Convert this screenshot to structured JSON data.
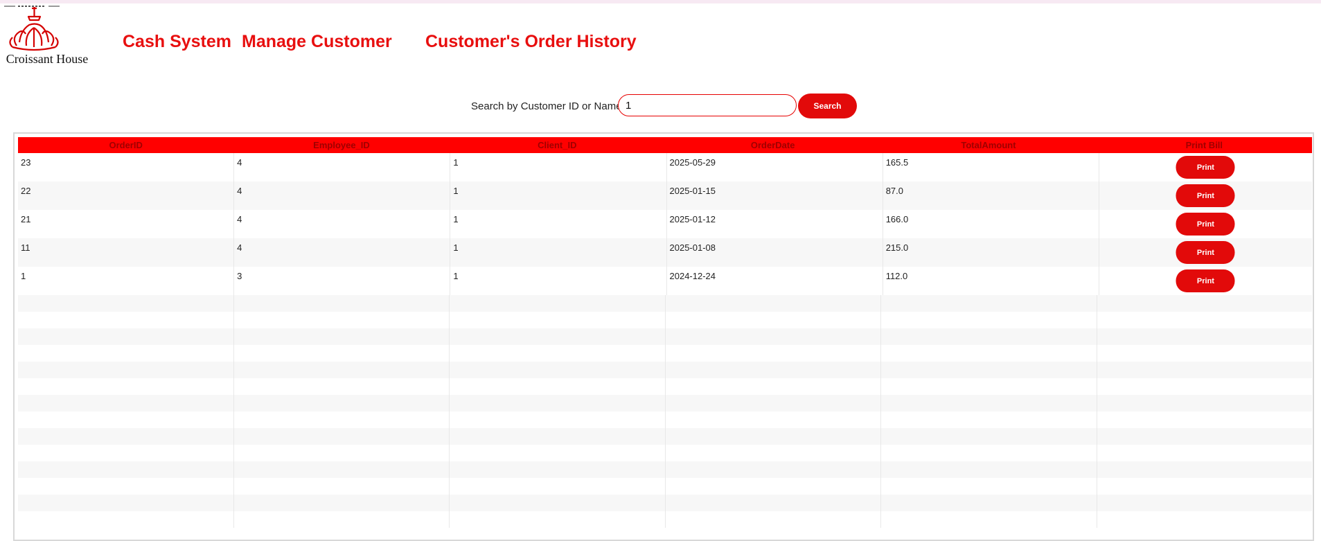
{
  "brand": {
    "name": "Croissant House",
    "accent_color": "#e80f0f",
    "logo_icon": "croissant-icon"
  },
  "nav": {
    "items": [
      {
        "label": "Cash System"
      },
      {
        "label": "Manage Customer"
      },
      {
        "label": "Customer's Order History"
      }
    ]
  },
  "search": {
    "label": "Search by Customer ID or Name:",
    "value": "1",
    "button_label": "Search"
  },
  "table": {
    "columns": [
      "OrderID",
      "Employee_ID",
      "Client_ID",
      "OrderDate",
      "TotalAmount",
      "Print Bill"
    ],
    "rows": [
      {
        "order_id": "23",
        "employee_id": "4",
        "client_id": "1",
        "order_date": "2025-05-29",
        "total": "165.5",
        "action": "Print"
      },
      {
        "order_id": "22",
        "employee_id": "4",
        "client_id": "1",
        "order_date": "2025-01-15",
        "total": "87.0",
        "action": "Print"
      },
      {
        "order_id": "21",
        "employee_id": "4",
        "client_id": "1",
        "order_date": "2025-01-12",
        "total": "166.0",
        "action": "Print"
      },
      {
        "order_id": "11",
        "employee_id": "4",
        "client_id": "1",
        "order_date": "2025-01-08",
        "total": "215.0",
        "action": "Print"
      },
      {
        "order_id": "1",
        "employee_id": "3",
        "client_id": "1",
        "order_date": "2024-12-24",
        "total": "112.0",
        "action": "Print"
      }
    ]
  }
}
